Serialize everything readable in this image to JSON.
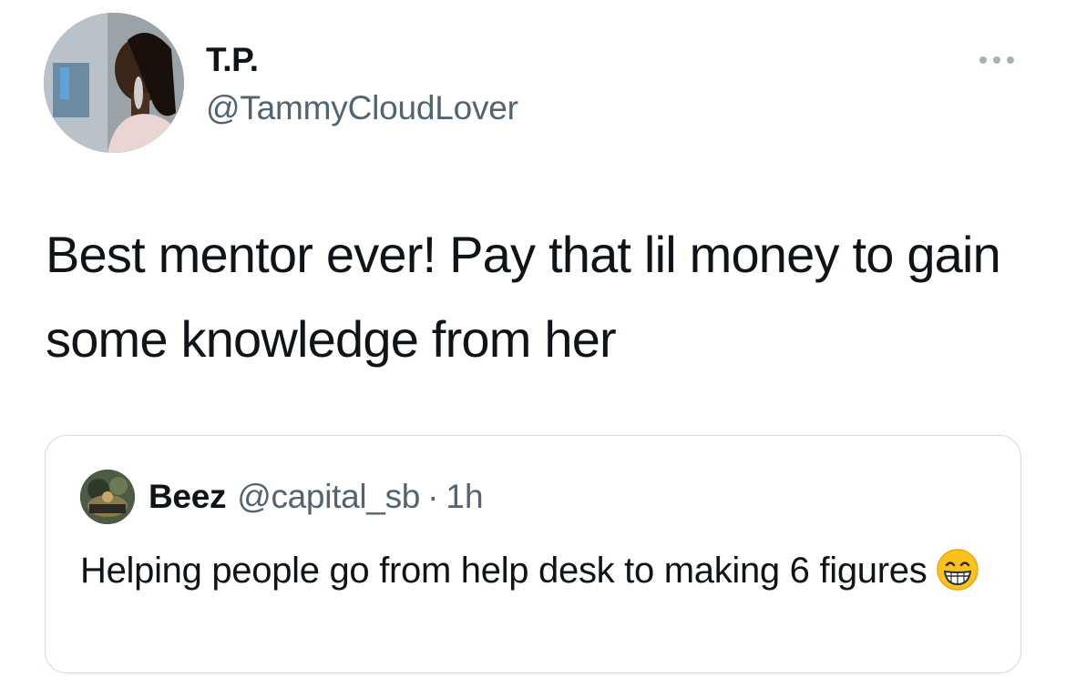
{
  "tweet": {
    "author": {
      "display_name": "T.P.",
      "handle": "@TammyCloudLover",
      "avatar_icon": "profile-photo"
    },
    "more_icon": "more-horizontal-icon",
    "text": "Best mentor ever! Pay that lil money to gain some knowledge from her"
  },
  "quoted_tweet": {
    "author": {
      "display_name": "Beez",
      "handle": "@capital_sb",
      "avatar_icon": "profile-photo"
    },
    "separator": "·",
    "time": "1h",
    "text": "Helping people go from help desk to making 6 figures",
    "emoji": "grinning-face-with-smiling-eyes"
  },
  "colors": {
    "text_primary": "#0f1419",
    "text_secondary": "#536471",
    "border": "#cfd9de"
  }
}
